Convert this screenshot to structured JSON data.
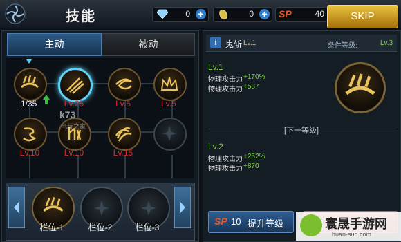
{
  "header": {
    "title": "技能",
    "gems": "0",
    "coins": "0",
    "sp_label": "SP",
    "sp_value": "40",
    "skip_label": "SKIP"
  },
  "tabs": [
    {
      "label": "主动",
      "active": true
    },
    {
      "label": "被动",
      "active": false
    }
  ],
  "skills": [
    {
      "name": "skill-1",
      "level_text": "",
      "count": "1/35",
      "locked": false
    },
    {
      "name": "skill-2",
      "level_text": "Lv.25",
      "count": "",
      "locked": false,
      "selected": true
    },
    {
      "name": "skill-3",
      "level_text": "Lv.5",
      "count": "",
      "locked": false
    },
    {
      "name": "skill-4",
      "level_text": "Lv.5",
      "count": "",
      "locked": false
    },
    {
      "name": "skill-5",
      "level_text": "Lv.10",
      "count": "",
      "locked": false
    },
    {
      "name": "skill-6",
      "level_text": "Lv.10",
      "count": "",
      "locked": false
    },
    {
      "name": "skill-7",
      "level_text": "Lv.15",
      "count": "",
      "locked": false
    },
    {
      "name": "skill-8",
      "level_text": "",
      "count": "",
      "locked": true
    }
  ],
  "slots": [
    {
      "label": "栏位-1"
    },
    {
      "label": "栏位-2"
    },
    {
      "label": "栏位-3"
    }
  ],
  "detail": {
    "skill_name": "鬼斩",
    "skill_lv": "Lv.1",
    "cond_label": "条件等级:",
    "cond_value": "Lv.3",
    "cur_level": "Lv.1",
    "cur_stats": [
      {
        "label": "物理攻击力",
        "value": "+170%"
      },
      {
        "label": "物理攻击力",
        "value": "+587"
      }
    ],
    "next_header": "[下一等级]",
    "next_level": "Lv.2",
    "next_stats": [
      {
        "label": "物理攻击力",
        "value": "+252%"
      },
      {
        "label": "物理攻击力",
        "value": "+870"
      }
    ],
    "upgrade_sp_label": "SP",
    "upgrade_cost": "10",
    "upgrade_label": "提升等级"
  },
  "watermarks": {
    "k73": "k73",
    "k73_sub": "电玩之家",
    "brand_cn": "寰晟手游网",
    "brand_en": "huan-sun.com"
  },
  "colors": {
    "accent_blue": "#2f6fb4",
    "skip_gold": "#e9c33f",
    "level_red": "#e22a2a",
    "stat_green": "#7fd34a",
    "sp_orange": "#e85a2c"
  }
}
